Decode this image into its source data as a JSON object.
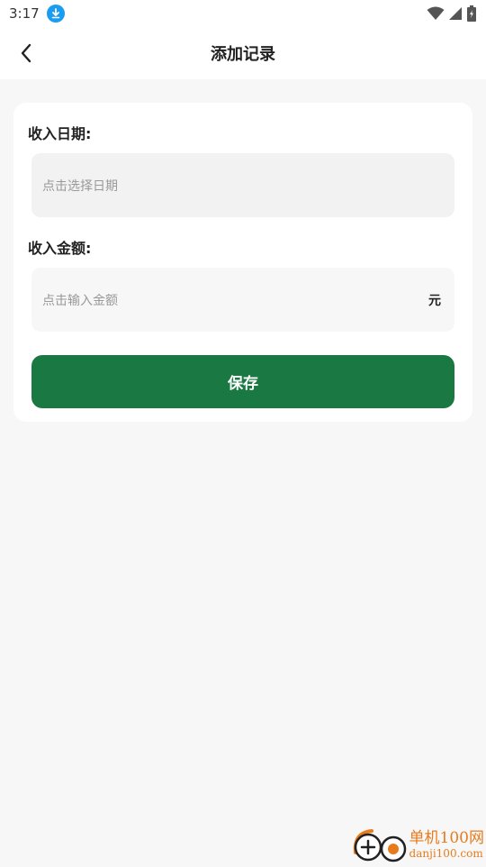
{
  "status_bar": {
    "time": "3:17"
  },
  "header": {
    "title": "添加记录"
  },
  "form": {
    "date_label": "收入日期:",
    "date_placeholder": "点击选择日期",
    "amount_label": "收入金额:",
    "amount_placeholder": "点击输入金额",
    "amount_unit": "元",
    "save_label": "保存"
  },
  "watermark": {
    "name": "单机100网",
    "domain": "danji100.com"
  },
  "colors": {
    "primary": "#1a7843",
    "background": "#f7f7f7",
    "card": "#ffffff",
    "watermark": "#e87b1c"
  }
}
